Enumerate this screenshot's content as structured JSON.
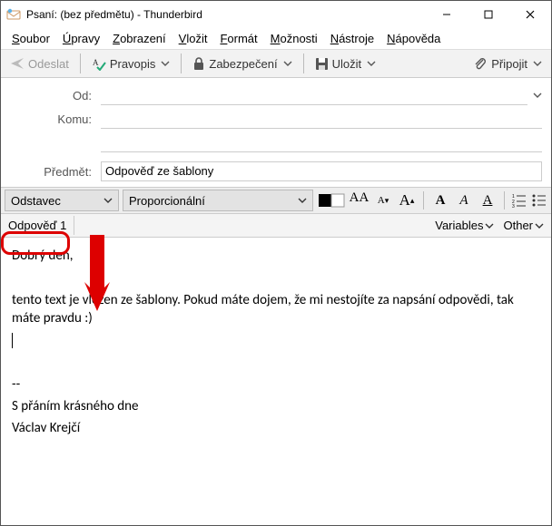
{
  "window": {
    "title": "Psaní: (bez předmětu) - Thunderbird"
  },
  "menubar": {
    "items": [
      {
        "u": "S",
        "rest": "oubor"
      },
      {
        "u": "Ú",
        "rest": "pravy"
      },
      {
        "u": "Z",
        "rest": "obrazení"
      },
      {
        "u": "V",
        "rest": "ložit"
      },
      {
        "u": "F",
        "rest": "ormát"
      },
      {
        "u": "M",
        "rest": "ožnosti"
      },
      {
        "u": "N",
        "rest": "ástroje"
      },
      {
        "u": "N",
        "rest": "ápověda"
      }
    ]
  },
  "toolbar": {
    "send": "Odeslat",
    "spell": "Pravopis",
    "secure": "Zabezpečení",
    "save": "Uložit",
    "attach": "Připojit"
  },
  "headers": {
    "from_label": "Od:",
    "from_value": "",
    "to_label": "Komu:",
    "to_value": "",
    "subject_label": "Předmět:",
    "subject_value": "Odpověď ze šablony"
  },
  "format": {
    "paragraph": "Odstavec",
    "font": "Proporcionální"
  },
  "tabs": {
    "tab1": "Odpověď 1",
    "variables": "Variables",
    "other": "Other"
  },
  "body": {
    "greeting": "Dobrý den,",
    "p1": "tento text je vložen ze šablony. Pokud máte dojem, že mi nestojíte za napsání odpovědi, tak máte pravdu :)",
    "sigdash": "--",
    "sig1": "S přáním krásného dne",
    "sig2": "Václav Krejčí"
  }
}
